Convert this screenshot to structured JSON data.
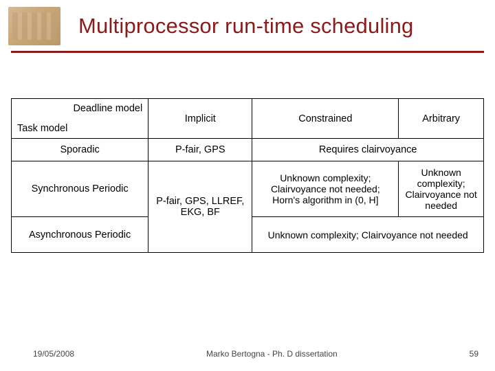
{
  "title": "Multiprocessor run-time scheduling",
  "header": {
    "deadline_label": "Deadline model",
    "task_label": "Task model",
    "cols": [
      "Implicit",
      "Constrained",
      "Arbitrary"
    ]
  },
  "rows": {
    "sporadic": {
      "label": "Sporadic",
      "implicit": "P-fair, GPS",
      "span": "Requires clairvoyance"
    },
    "sync": {
      "label": "Synchronous Periodic",
      "shared_implicit": "P-fair, GPS, LLREF, EKG, BF",
      "constrained": "Unknown complexity; Clairvoyance not needed; Horn's algorithm in (0, H]",
      "arbitrary": "Unknown complexity; Clairvoyance not needed"
    },
    "async": {
      "label": "Asynchronous Periodic",
      "span": "Unknown complexity; Clairvoyance not needed"
    }
  },
  "footer": {
    "date": "19/05/2008",
    "center": "Marko Bertogna - Ph. D dissertation",
    "page": "59"
  }
}
